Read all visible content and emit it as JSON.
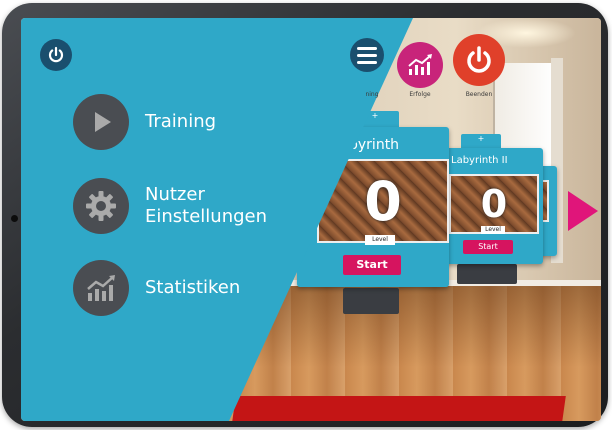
{
  "app": {
    "menu": {
      "training_label": "Training",
      "settings_label": "Nutzer\nEinstellungen",
      "stats_label": "Statistiken"
    },
    "top_buttons": {
      "achievements_label": "Erfolge",
      "quit_label": "Beenden",
      "partial_left_label": "ning"
    },
    "cards": [
      {
        "tab": "+",
        "title": "byrinth",
        "level_value": "0",
        "level_label": "Level",
        "start_label": "Start"
      },
      {
        "tab": "+",
        "title": "Labyrinth II",
        "level_value": "0",
        "level_label": "Level",
        "start_label": "Start"
      }
    ],
    "colors": {
      "panel": "#2fa8c8",
      "accent_pink": "#d6145f",
      "quit_red": "#e0402a",
      "achievements_magenta": "#c8247a",
      "icon_dark": "#4a4d52"
    },
    "icons": [
      "power-icon",
      "play-icon",
      "gear-icon",
      "chart-icon",
      "hamburger-icon",
      "arrow-right-icon"
    ]
  }
}
